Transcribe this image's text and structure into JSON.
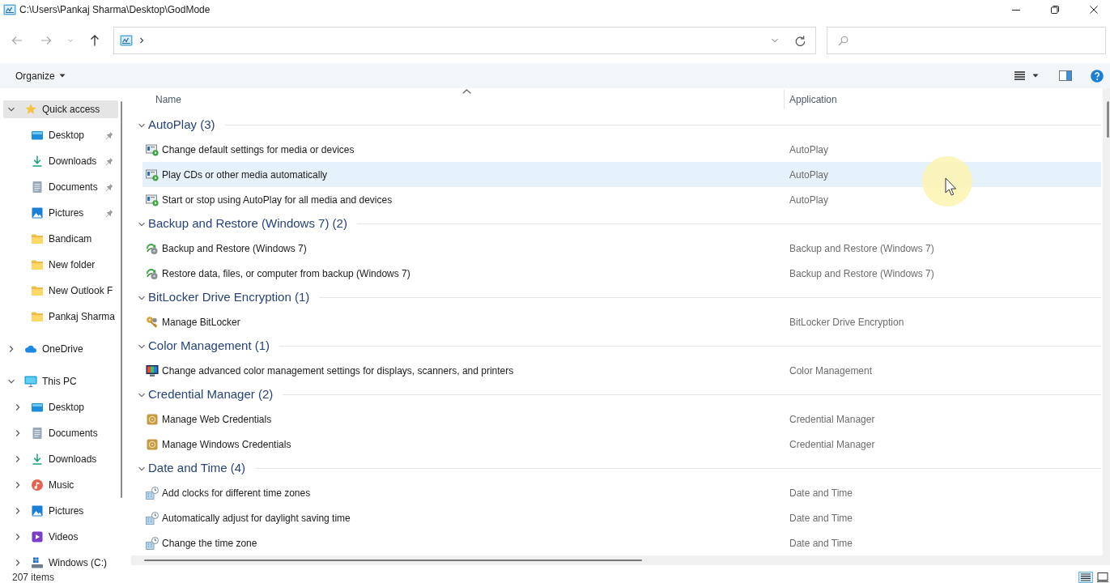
{
  "window": {
    "title": "C:\\Users\\Pankaj Sharma\\Desktop\\GodMode"
  },
  "nav_buttons": [
    {
      "kind": "back",
      "disabled": true
    },
    {
      "kind": "forward",
      "disabled": true
    },
    {
      "kind": "recent",
      "disabled": true
    },
    {
      "kind": "up",
      "disabled": false
    }
  ],
  "toolbar": {
    "organize": "Organize"
  },
  "sidebar": {
    "items": [
      {
        "label": "Quick access",
        "kind": "star",
        "expanded": true,
        "selected": true,
        "children": [
          {
            "label": "Desktop",
            "kind": "desktop",
            "pinned": true,
            "selected": false
          },
          {
            "label": "Downloads",
            "kind": "downloads",
            "pinned": true,
            "selected": false
          },
          {
            "label": "Documents",
            "kind": "documents",
            "pinned": true,
            "selected": false
          },
          {
            "label": "Pictures",
            "kind": "pictures",
            "pinned": true,
            "selected": false
          },
          {
            "label": "Bandicam",
            "kind": "folder",
            "pinned": false,
            "selected": false
          },
          {
            "label": "New folder",
            "kind": "folder",
            "pinned": false,
            "selected": false
          },
          {
            "label": "New Outlook F",
            "kind": "folder",
            "pinned": false,
            "selected": false
          },
          {
            "label": "Pankaj Sharma",
            "kind": "folder",
            "pinned": false,
            "selected": false
          }
        ]
      },
      {
        "label": "OneDrive",
        "kind": "cloud",
        "expanded": false,
        "selected": false
      },
      {
        "label": "This PC",
        "kind": "pc",
        "expanded": true,
        "selected": false,
        "children": [
          {
            "label": "Desktop",
            "kind": "desktop",
            "expanded": false,
            "selected": false
          },
          {
            "label": "Documents",
            "kind": "documents",
            "expanded": false,
            "selected": false
          },
          {
            "label": "Downloads",
            "kind": "downloads",
            "expanded": false,
            "selected": false
          },
          {
            "label": "Music",
            "kind": "music",
            "expanded": false,
            "selected": false
          },
          {
            "label": "Pictures",
            "kind": "pictures",
            "expanded": false,
            "selected": false
          },
          {
            "label": "Videos",
            "kind": "videos",
            "expanded": false,
            "selected": false
          },
          {
            "label": "Windows (C:)",
            "kind": "drive",
            "expanded": false,
            "selected": false
          }
        ]
      }
    ]
  },
  "table": {
    "columns": [
      {
        "label": "Name",
        "sorted": true
      },
      {
        "label": "Application",
        "sorted": false
      }
    ],
    "groups": [
      {
        "title": "AutoPlay (3)",
        "expanded": true,
        "items": [
          {
            "name": "Change default settings for media or devices",
            "application": "AutoPlay",
            "kind": "autoplay",
            "hovered": false,
            "selected": false
          },
          {
            "name": "Play CDs or other media automatically",
            "application": "AutoPlay",
            "kind": "autoplay",
            "hovered": true,
            "selected": false
          },
          {
            "name": "Start or stop using AutoPlay for all media and devices",
            "application": "AutoPlay",
            "kind": "autoplay",
            "hovered": false,
            "selected": false
          }
        ]
      },
      {
        "title": "Backup and Restore (Windows 7) (2)",
        "expanded": true,
        "items": [
          {
            "name": "Backup and Restore (Windows 7)",
            "application": "Backup and Restore (Windows 7)",
            "kind": "backup",
            "hovered": false,
            "selected": false
          },
          {
            "name": "Restore data, files, or computer from backup (Windows 7)",
            "application": "Backup and Restore (Windows 7)",
            "kind": "backup",
            "hovered": false,
            "selected": false
          }
        ]
      },
      {
        "title": "BitLocker Drive Encryption (1)",
        "expanded": true,
        "items": [
          {
            "name": "Manage BitLocker",
            "application": "BitLocker Drive Encryption",
            "kind": "bitlocker",
            "hovered": false,
            "selected": false
          }
        ]
      },
      {
        "title": "Color Management (1)",
        "expanded": true,
        "items": [
          {
            "name": "Change advanced color management settings for displays, scanners, and printers",
            "application": "Color Management",
            "kind": "color",
            "hovered": false,
            "selected": false
          }
        ]
      },
      {
        "title": "Credential Manager (2)",
        "expanded": true,
        "items": [
          {
            "name": "Manage Web Credentials",
            "application": "Credential Manager",
            "kind": "credential",
            "hovered": false,
            "selected": false
          },
          {
            "name": "Manage Windows Credentials",
            "application": "Credential Manager",
            "kind": "credential",
            "hovered": false,
            "selected": false
          }
        ]
      },
      {
        "title": "Date and Time (4)",
        "expanded": true,
        "items": [
          {
            "name": "Add clocks for different time zones",
            "application": "Date and Time",
            "kind": "datetime",
            "hovered": false,
            "selected": false
          },
          {
            "name": "Automatically adjust for daylight saving time",
            "application": "Date and Time",
            "kind": "datetime",
            "hovered": false,
            "selected": false
          },
          {
            "name": "Change the time zone",
            "application": "Date and Time",
            "kind": "datetime",
            "hovered": false,
            "selected": false
          }
        ]
      }
    ]
  },
  "status_bar": {
    "count": "207 items"
  },
  "view_buttons": [
    {
      "kind": "details",
      "selected": true
    },
    {
      "kind": "large-icons",
      "selected": false
    }
  ]
}
